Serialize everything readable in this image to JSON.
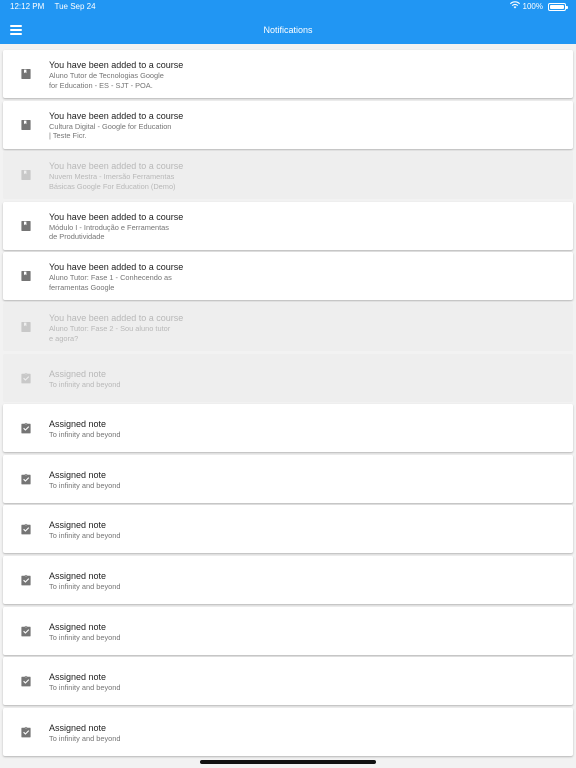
{
  "status_bar": {
    "time": "12:12 PM",
    "date": "Tue Sep 24",
    "battery": "100%"
  },
  "app_bar": {
    "title": "Notifications"
  },
  "notifications": [
    {
      "title": "You have been added to a course",
      "lines": [
        "Aluno Tutor de Tecnologias Google",
        "for Education - ES - SJT - POA."
      ],
      "read": false,
      "icon": "book-icon"
    },
    {
      "title": "You have been added to a course",
      "lines": [
        "Cultura Digital - Google for Education",
        "| Teste Ficr."
      ],
      "read": false,
      "icon": "book-icon"
    },
    {
      "title": "You have been added to a course",
      "lines": [
        "Nuvem Mestra - Imersão Ferramentas",
        "Básicas Google For Education (Demo)"
      ],
      "read": true,
      "icon": "book-icon"
    },
    {
      "title": "You have been added to a course",
      "lines": [
        "Módulo I - Introdução e Ferramentas",
        "de Produtividade"
      ],
      "read": false,
      "icon": "book-icon"
    },
    {
      "title": "You have been added to a course",
      "lines": [
        "Aluno Tutor: Fase 1 - Conhecendo as",
        "ferramentas Google"
      ],
      "read": false,
      "icon": "book-icon"
    },
    {
      "title": "You have been added to a course",
      "lines": [
        "Aluno Tutor: Fase 2 - Sou aluno tutor",
        "e agora?"
      ],
      "read": true,
      "icon": "book-icon"
    },
    {
      "title": "Assigned note",
      "lines": [
        "To infinity and beyond"
      ],
      "read": true,
      "icon": "clipboard-check-icon"
    },
    {
      "title": "Assigned note",
      "lines": [
        "To infinity and beyond"
      ],
      "read": false,
      "icon": "clipboard-check-icon"
    },
    {
      "title": "Assigned note",
      "lines": [
        "To infinity and beyond"
      ],
      "read": false,
      "icon": "clipboard-check-icon"
    },
    {
      "title": "Assigned note",
      "lines": [
        "To infinity and beyond"
      ],
      "read": false,
      "icon": "clipboard-check-icon"
    },
    {
      "title": "Assigned note",
      "lines": [
        "To infinity and beyond"
      ],
      "read": false,
      "icon": "clipboard-check-icon"
    },
    {
      "title": "Assigned note",
      "lines": [
        "To infinity and beyond"
      ],
      "read": false,
      "icon": "clipboard-check-icon"
    },
    {
      "title": "Assigned note",
      "lines": [
        "To infinity and beyond"
      ],
      "read": false,
      "icon": "clipboard-check-icon"
    },
    {
      "title": "Assigned note",
      "lines": [
        "To infinity and beyond"
      ],
      "read": false,
      "icon": "clipboard-check-icon"
    }
  ],
  "colors": {
    "app_bar": "#2196f3",
    "background": "#f2f2f2",
    "card": "#ffffff",
    "card_read": "#eeeeee"
  }
}
